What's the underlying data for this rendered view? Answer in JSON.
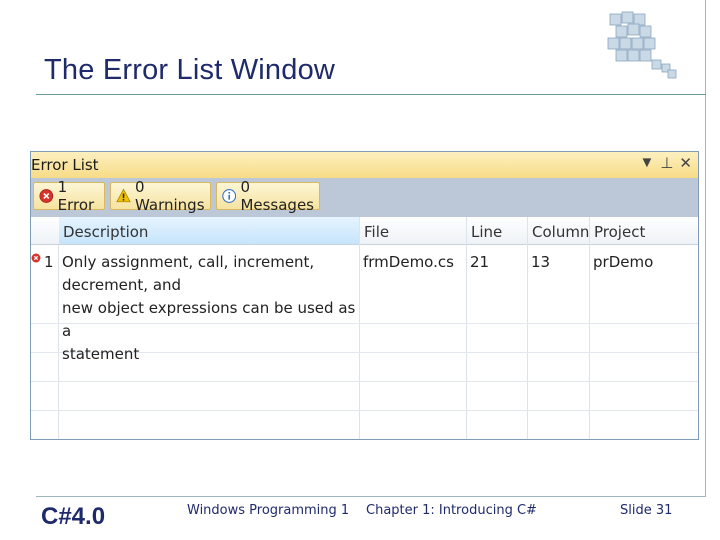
{
  "slide": {
    "title": "The Error List Window",
    "footer": {
      "brand": "C#4.0",
      "course": "Windows Programming 1",
      "chapter": "Chapter 1: Introducing C#",
      "slide_number": "Slide 31"
    }
  },
  "error_list": {
    "title": "Error List",
    "controls": [
      "▼",
      "⊥",
      "✕"
    ],
    "filters": {
      "errors": "1 Error",
      "warnings": "0 Warnings",
      "messages": "0 Messages"
    },
    "columns": {
      "description": "Description",
      "file": "File",
      "line": "Line",
      "column": "Column",
      "project": "Project"
    },
    "rows": [
      {
        "number": "1",
        "description_lines": [
          "Only assignment, call, increment, decrement, and",
          "new object expressions can be used as a",
          "statement"
        ],
        "file": "frmDemo.cs",
        "line": "21",
        "column": "13",
        "project": "prDemo"
      }
    ]
  },
  "colors": {
    "title_text": "#1f2a6b",
    "error_icon": "#d8332a",
    "warning_icon": "#f2c200",
    "info_icon": "#3a74c4",
    "header_selected": "#c6e4fb"
  },
  "icons": [
    "cube-logo-icon",
    "error-icon",
    "warning-icon",
    "info-icon",
    "dropdown-icon",
    "pin-icon",
    "close-icon"
  ]
}
